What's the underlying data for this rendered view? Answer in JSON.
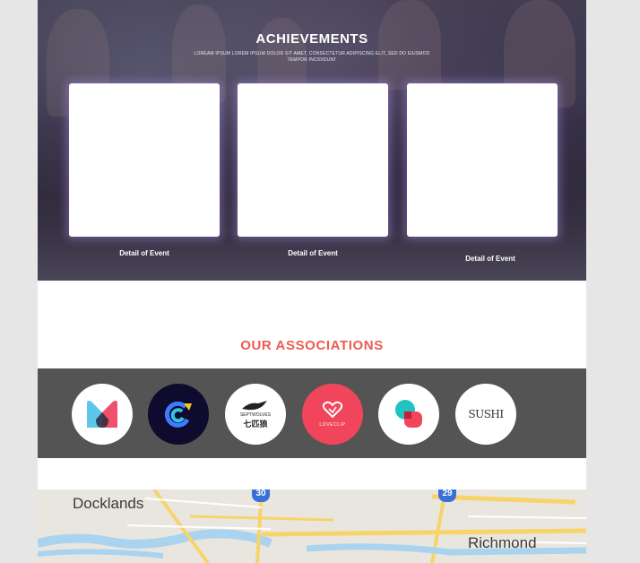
{
  "achievements": {
    "title": "ACHIEVEMENTS",
    "subtitle": "LOREAM IPSUM LOREM IPSUM DOLOR SIT AMET, CONSECTETUR ADIPISCING ELIT, SED DO EIUSMOD TEMPOR INCIDIDUNT",
    "cards": [
      {
        "label": "Detail of Event"
      },
      {
        "label": "Detail of Event"
      },
      {
        "label": "Detail of Event"
      }
    ]
  },
  "associations": {
    "title": "OUR ASSOCIATIONS",
    "logos": [
      {
        "name": "m-logo",
        "text": ""
      },
      {
        "name": "c-swirl-logo",
        "text": ""
      },
      {
        "name": "septwolves-logo",
        "text": "SEPTWOLVES",
        "subtext": "七匹狼"
      },
      {
        "name": "loveclip-logo",
        "text": "LOVECLIP"
      },
      {
        "name": "b-logo",
        "text": ""
      },
      {
        "name": "sushi-logo",
        "text": "SUSHI"
      }
    ]
  },
  "map": {
    "labels": [
      "Docklands",
      "Richmond"
    ],
    "route_shields": [
      "30",
      "29"
    ]
  },
  "colors": {
    "accent": "#ef5a4f",
    "band": "#545454",
    "loveclip": "#f0455b",
    "c_logo_bg": "#0e0b2e"
  }
}
